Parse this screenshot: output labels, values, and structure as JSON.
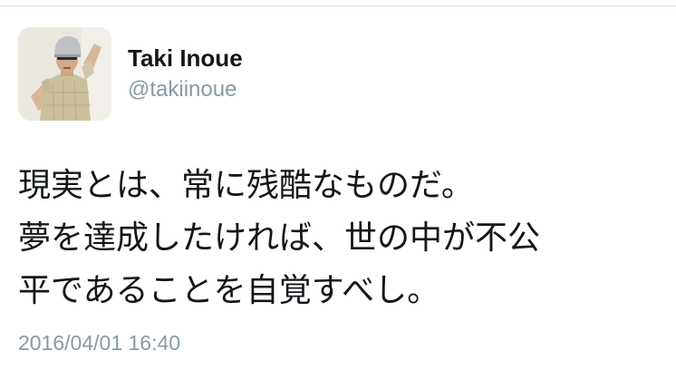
{
  "tweet": {
    "author": {
      "display_name": "Taki Inoue",
      "handle": "@takiinoue",
      "avatar_icon": "profile-photo"
    },
    "text_lines": [
      "現実とは、常に残酷なものだ。",
      "夢を達成したければ、世の中が不公",
      "平であることを自覚すべし。"
    ],
    "timestamp": "2016/04/01 16:40"
  },
  "colors": {
    "name": "#14171a",
    "secondary": "#8899a6",
    "divider": "#d8d8d8",
    "background": "#ffffff"
  }
}
